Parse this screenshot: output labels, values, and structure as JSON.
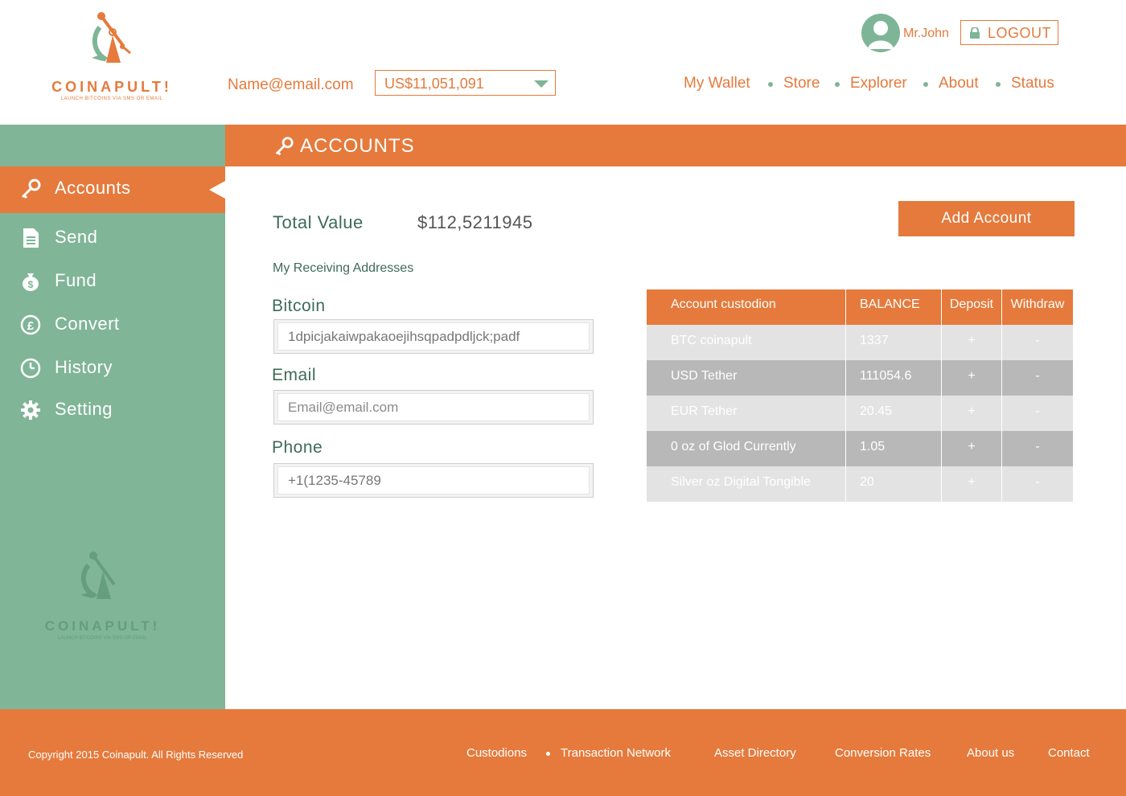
{
  "brand": {
    "logo_text": "COINAPULT!",
    "logo_tagline": "LAUNCH BITCOINS VIA SMS OR EMAIL",
    "colors": {
      "orange": "#e57a3c",
      "green": "#80b597",
      "table_light": "#e3e3e3",
      "table_dark": "#b8b8b8"
    }
  },
  "header": {
    "email": "Name@email.com",
    "balance_selected": "US$11,051,091",
    "user_name": "Mr.John",
    "logout_label": "LOGOUT",
    "nav": [
      "My Wallet",
      "Store",
      "Explorer",
      "About",
      "Status"
    ]
  },
  "sidebar": {
    "items": [
      {
        "label": "Accounts",
        "icon": "key-icon",
        "active": true
      },
      {
        "label": "Send",
        "icon": "document-icon"
      },
      {
        "label": "Fund",
        "icon": "money-bag-icon"
      },
      {
        "label": "Convert",
        "icon": "currency-exchange-icon"
      },
      {
        "label": "History",
        "icon": "clock-icon"
      },
      {
        "label": "Setting",
        "icon": "gear-icon"
      }
    ]
  },
  "section": {
    "title": "ACCOUNTS",
    "icon": "key-icon"
  },
  "main": {
    "total_label": "Total Value",
    "total_value": "$112,5211945",
    "add_account_label": "Add Account",
    "receiving_title": "My Receiving Addresses",
    "fields": {
      "bitcoin": {
        "label": "Bitcoin",
        "value": "1dpicjakaiwpakaoejihsqpadpdljck;padf"
      },
      "email": {
        "label": "Email",
        "placeholder": "Email@email.com"
      },
      "phone": {
        "label": "Phone",
        "value": "+1(1235-45789"
      }
    }
  },
  "table": {
    "headers": [
      "Account custodion",
      "BALANCE",
      "Deposit",
      "Withdraw"
    ],
    "rows": [
      {
        "custodian": "BTC coinapult",
        "balance": "1337",
        "deposit": "+",
        "withdraw": "-"
      },
      {
        "custodian": "USD Tether",
        "balance": "111054.6",
        "deposit": "+",
        "withdraw": "-"
      },
      {
        "custodian": "EUR Tether",
        "balance": "20.45",
        "deposit": "+",
        "withdraw": "-"
      },
      {
        "custodian": "0 oz of Glod Currently",
        "balance": "1.05",
        "deposit": "+",
        "withdraw": "-"
      },
      {
        "custodian": "Silver oz Digital Tongible",
        "balance": "20",
        "deposit": "+",
        "withdraw": "-"
      }
    ]
  },
  "footer": {
    "copyright": "Copyright 2015 Coinapult. All Rights Reserved",
    "links": [
      "Custodions",
      "Transaction Network",
      "Asset Directory",
      "Conversion Rates",
      "About us",
      "Contact"
    ]
  }
}
